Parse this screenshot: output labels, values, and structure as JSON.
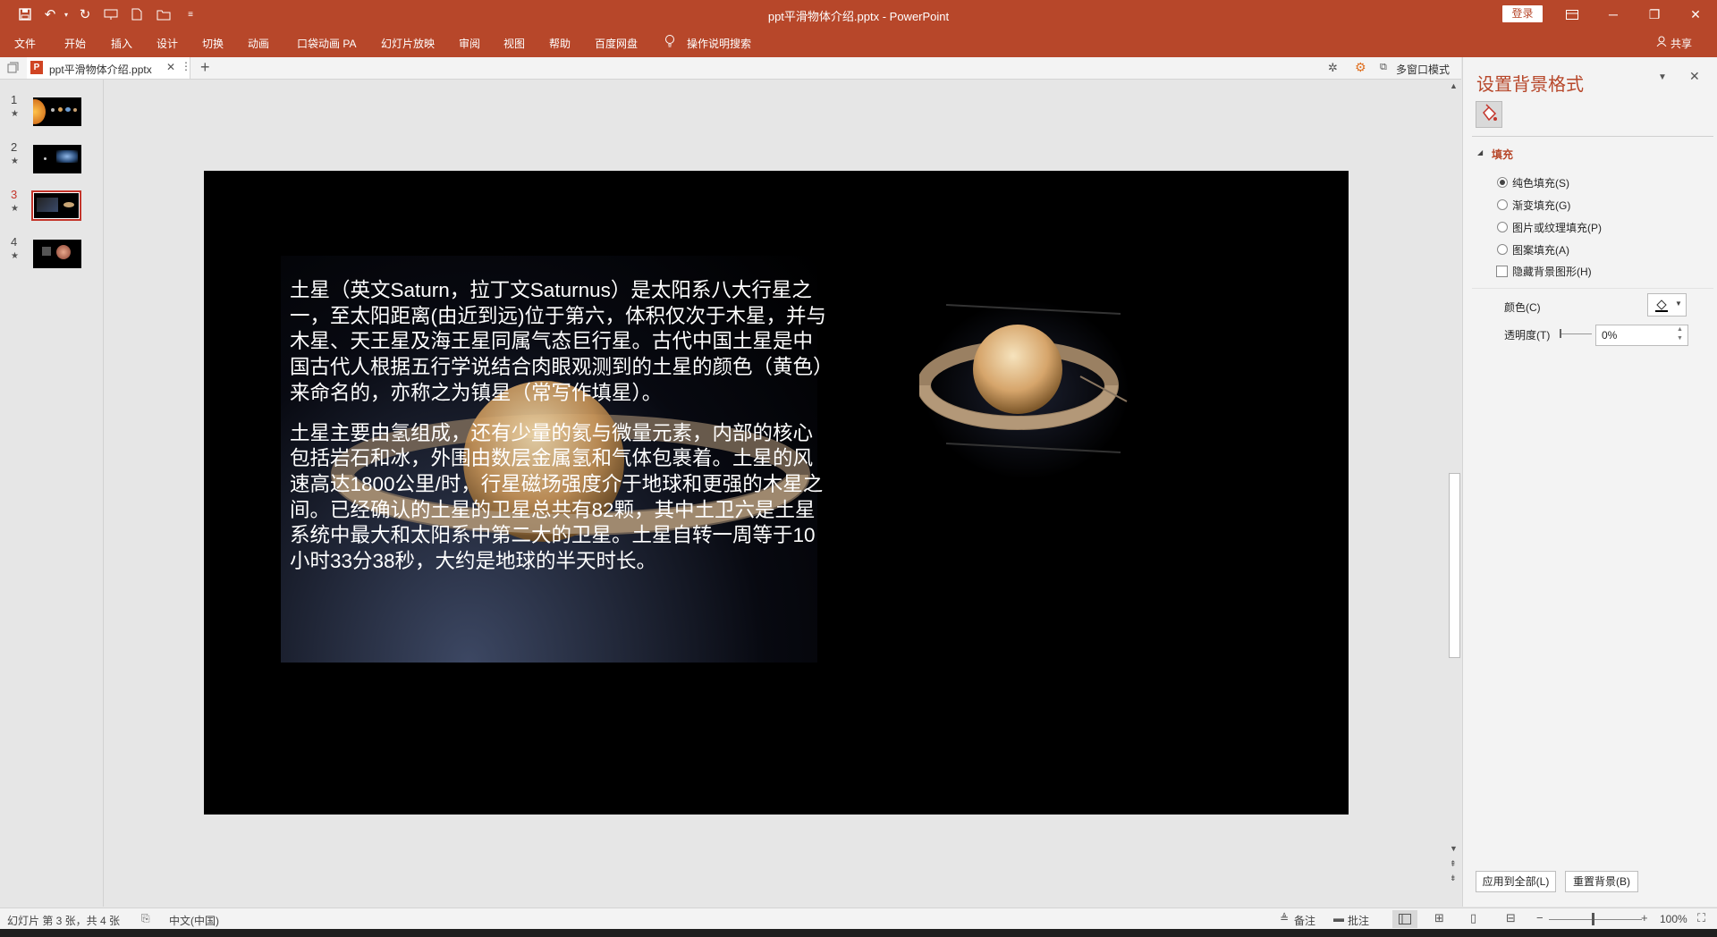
{
  "window": {
    "doc_title": "ppt平滑物体介绍.pptx  -  PowerPoint",
    "login_label": "登录",
    "share_label": "共享"
  },
  "ribbon": {
    "tabs": [
      "文件",
      "开始",
      "插入",
      "设计",
      "切换",
      "动画",
      "口袋动画 PA",
      "幻灯片放映",
      "审阅",
      "视图",
      "帮助",
      "百度网盘"
    ],
    "tell_me": "操作说明搜索"
  },
  "doc_tabs": {
    "active_name": "ppt平滑物体介绍.pptx",
    "multiwindow_label": "多窗口模式"
  },
  "thumbnails": [
    {
      "num": "1",
      "star": "★"
    },
    {
      "num": "2",
      "star": "★"
    },
    {
      "num": "3",
      "star": "★"
    },
    {
      "num": "4",
      "star": "★"
    }
  ],
  "slide": {
    "para1": "土星（英文Saturn，拉丁文Saturnus）是太阳系八大行星之一，至太阳距离(由近到远)位于第六，体积仅次于木星，并与木星、天王星及海王星同属气态巨行星。古代中国土星是中国古代人根据五行学说结合肉眼观测到的土星的颜色（黄色）来命名的，亦称之为镇星（常写作填星）。",
    "para2": "土星主要由氢组成，还有少量的氦与微量元素，内部的核心包括岩石和冰，外围由数层金属氢和气体包裹着。土星的风速高达1800公里/时，行星磁场强度介于地球和更强的木星之间。已经确认的土星的卫星总共有82颗，其中土卫六是土星系统中最大和太阳系中第二大的卫星。土星自转一周等于10小时33分38秒，大约是地球的半天时长。"
  },
  "format_pane": {
    "title": "设置背景格式",
    "section": "填充",
    "options": [
      "纯色填充(S)",
      "渐变填充(G)",
      "图片或纹理填充(P)",
      "图案填充(A)"
    ],
    "hide_bg": "隐藏背景图形(H)",
    "color_label": "颜色(C)",
    "transparency_label": "透明度(T)",
    "transparency_value": "0%",
    "apply_all": "应用到全部(L)",
    "reset_bg": "重置背景(B)"
  },
  "status": {
    "slide_info": "幻灯片 第 3 张，共 4 张",
    "language": "中文(中国)",
    "notes": "备注",
    "comments": "批注",
    "zoom": "100%"
  }
}
